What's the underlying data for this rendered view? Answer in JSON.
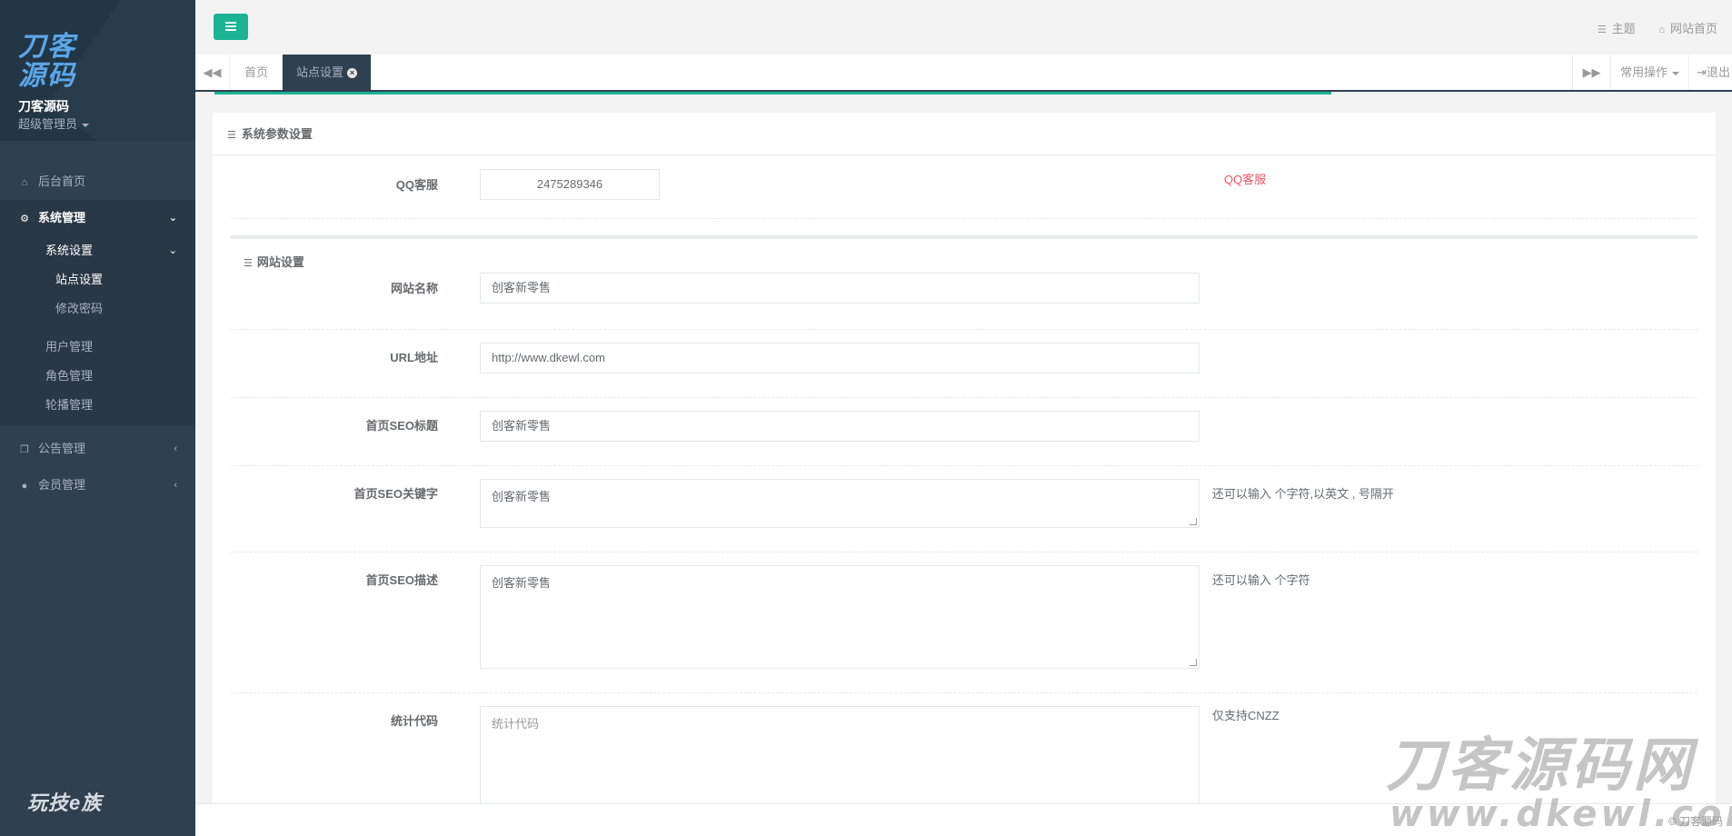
{
  "sidebar": {
    "logo_text": "刀客源码",
    "brand_name": "刀客源码",
    "role": "超级管理员",
    "nav": {
      "home": "后台首页",
      "system": "系统管理",
      "system_settings": "系统设置",
      "site_settings": "站点设置",
      "change_password": "修改密码",
      "user_mgmt": "用户管理",
      "role_mgmt": "角色管理",
      "carousel_mgmt": "轮播管理",
      "notice_mgmt": "公告管理",
      "member_mgmt": "会员管理"
    },
    "bottom_logo": "玩技e族"
  },
  "topbar": {
    "theme": "主题",
    "site_home": "网站首页"
  },
  "tabs": {
    "home": "首页",
    "active": "站点设置",
    "common_ops": "常用操作",
    "logout": "退出"
  },
  "panel": {
    "title": "系统参数设置",
    "qq_label": "QQ客服",
    "qq_value": "2475289346",
    "qq_hint": "QQ客服",
    "section_title": "网站设置",
    "site_name_label": "网站名称",
    "site_name_value": "创客新零售",
    "url_label": "URL地址",
    "url_value": "http://www.dkewl.com",
    "seo_title_label": "首页SEO标题",
    "seo_title_value": "创客新零售",
    "seo_keywords_label": "首页SEO关键字",
    "seo_keywords_value": "创客新零售",
    "seo_keywords_hint": "还可以输入 个字符,以英文 , 号隔开",
    "seo_desc_label": "首页SEO描述",
    "seo_desc_value": "创客新零售",
    "seo_desc_hint": "还可以输入 个字符",
    "stats_label": "统计代码",
    "stats_placeholder": "统计代码",
    "stats_hint": "仅支持CNZZ"
  },
  "footer": {
    "copyright": "© 刀客源码"
  },
  "watermark": {
    "big": "刀客源码网",
    "url": "www.dkewl.com"
  },
  "colors": {
    "sidebar": "#2f4050",
    "accent": "#1ab394",
    "red": "#ed5565"
  }
}
